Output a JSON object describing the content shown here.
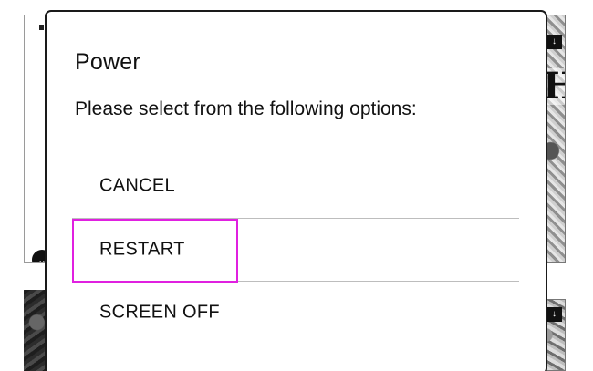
{
  "background": {
    "cover_letter": "H",
    "badge_icon": "chevron-down-icon",
    "colors": {
      "highlight": "#e020e0",
      "dialog_border": "#1a1a1a",
      "divider": "#bdbdbd"
    }
  },
  "dialog": {
    "title": "Power",
    "message": "Please select from the following options:",
    "options": [
      {
        "label": "CANCEL"
      },
      {
        "label": "RESTART",
        "highlighted": true
      },
      {
        "label": "SCREEN OFF"
      }
    ]
  }
}
